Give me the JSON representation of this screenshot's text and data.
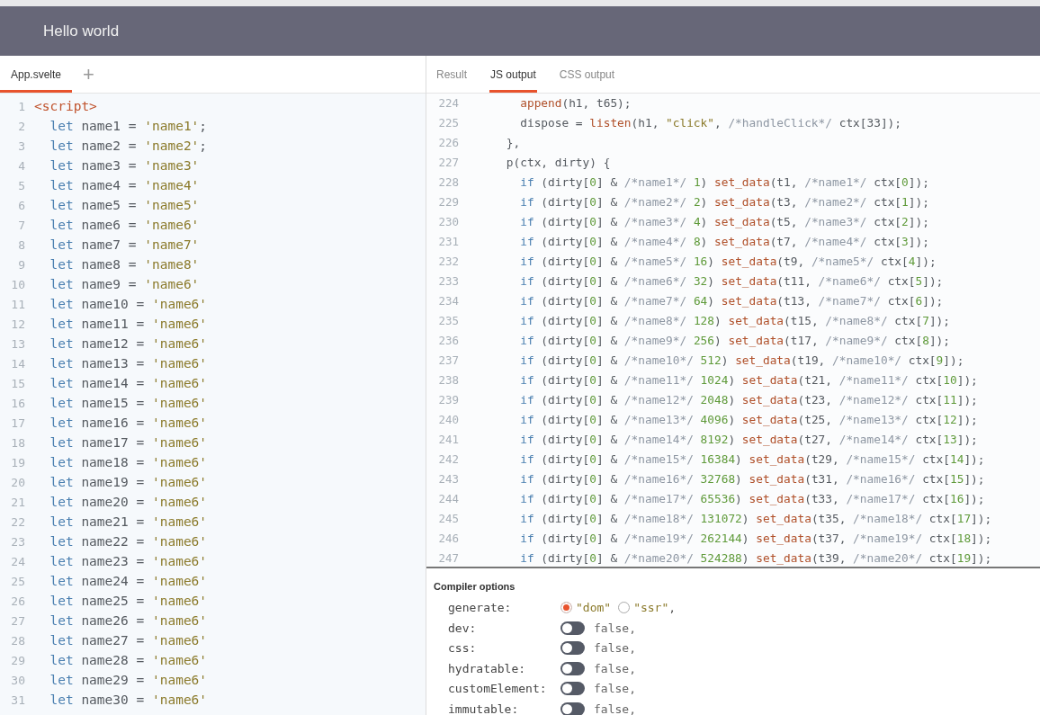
{
  "header": {
    "title": "Hello world"
  },
  "editor": {
    "tabs": [
      {
        "label": "App.svelte",
        "selected": true
      }
    ],
    "add_button": "+",
    "lines": [
      {
        "number": "1",
        "tokens": [
          {
            "kind": "tag",
            "text": "<script>"
          }
        ]
      },
      {
        "number": "2",
        "tokens": [
          {
            "kind": "keyword",
            "text": "  let"
          },
          {
            "kind": "plain",
            "text": " name1 = "
          },
          {
            "kind": "string",
            "text": "'name1'"
          },
          {
            "kind": "plain",
            "text": ";"
          }
        ]
      },
      {
        "number": "3",
        "tokens": [
          {
            "kind": "keyword",
            "text": "  let"
          },
          {
            "kind": "plain",
            "text": " name2 = "
          },
          {
            "kind": "string",
            "text": "'name2'"
          },
          {
            "kind": "plain",
            "text": ";"
          }
        ]
      },
      {
        "number": "4",
        "tokens": [
          {
            "kind": "keyword",
            "text": "  let"
          },
          {
            "kind": "plain",
            "text": " name3 = "
          },
          {
            "kind": "string",
            "text": "'name3'"
          }
        ]
      },
      {
        "number": "5",
        "tokens": [
          {
            "kind": "keyword",
            "text": "  let"
          },
          {
            "kind": "plain",
            "text": " name4 = "
          },
          {
            "kind": "string",
            "text": "'name4'"
          }
        ]
      },
      {
        "number": "6",
        "tokens": [
          {
            "kind": "keyword",
            "text": "  let"
          },
          {
            "kind": "plain",
            "text": " name5 = "
          },
          {
            "kind": "string",
            "text": "'name5'"
          }
        ]
      },
      {
        "number": "7",
        "tokens": [
          {
            "kind": "keyword",
            "text": "  let"
          },
          {
            "kind": "plain",
            "text": " name6 = "
          },
          {
            "kind": "string",
            "text": "'name6'"
          }
        ]
      },
      {
        "number": "8",
        "tokens": [
          {
            "kind": "keyword",
            "text": "  let"
          },
          {
            "kind": "plain",
            "text": " name7 = "
          },
          {
            "kind": "string",
            "text": "'name7'"
          }
        ]
      },
      {
        "number": "9",
        "tokens": [
          {
            "kind": "keyword",
            "text": "  let"
          },
          {
            "kind": "plain",
            "text": " name8 = "
          },
          {
            "kind": "string",
            "text": "'name8'"
          }
        ]
      },
      {
        "number": "10",
        "tokens": [
          {
            "kind": "keyword",
            "text": "  let"
          },
          {
            "kind": "plain",
            "text": " name9 = "
          },
          {
            "kind": "string",
            "text": "'name6'"
          }
        ]
      },
      {
        "number": "11",
        "tokens": [
          {
            "kind": "keyword",
            "text": "  let"
          },
          {
            "kind": "plain",
            "text": " name10 = "
          },
          {
            "kind": "string",
            "text": "'name6'"
          }
        ]
      },
      {
        "number": "12",
        "tokens": [
          {
            "kind": "keyword",
            "text": "  let"
          },
          {
            "kind": "plain",
            "text": " name11 = "
          },
          {
            "kind": "string",
            "text": "'name6'"
          }
        ]
      },
      {
        "number": "13",
        "tokens": [
          {
            "kind": "keyword",
            "text": "  let"
          },
          {
            "kind": "plain",
            "text": " name12 = "
          },
          {
            "kind": "string",
            "text": "'name6'"
          }
        ]
      },
      {
        "number": "14",
        "tokens": [
          {
            "kind": "keyword",
            "text": "  let"
          },
          {
            "kind": "plain",
            "text": " name13 = "
          },
          {
            "kind": "string",
            "text": "'name6'"
          }
        ]
      },
      {
        "number": "15",
        "tokens": [
          {
            "kind": "keyword",
            "text": "  let"
          },
          {
            "kind": "plain",
            "text": " name14 = "
          },
          {
            "kind": "string",
            "text": "'name6'"
          }
        ]
      },
      {
        "number": "16",
        "tokens": [
          {
            "kind": "keyword",
            "text": "  let"
          },
          {
            "kind": "plain",
            "text": " name15 = "
          },
          {
            "kind": "string",
            "text": "'name6'"
          }
        ]
      },
      {
        "number": "17",
        "tokens": [
          {
            "kind": "keyword",
            "text": "  let"
          },
          {
            "kind": "plain",
            "text": " name16 = "
          },
          {
            "kind": "string",
            "text": "'name6'"
          }
        ]
      },
      {
        "number": "18",
        "tokens": [
          {
            "kind": "keyword",
            "text": "  let"
          },
          {
            "kind": "plain",
            "text": " name17 = "
          },
          {
            "kind": "string",
            "text": "'name6'"
          }
        ]
      },
      {
        "number": "19",
        "tokens": [
          {
            "kind": "keyword",
            "text": "  let"
          },
          {
            "kind": "plain",
            "text": " name18 = "
          },
          {
            "kind": "string",
            "text": "'name6'"
          }
        ]
      },
      {
        "number": "20",
        "tokens": [
          {
            "kind": "keyword",
            "text": "  let"
          },
          {
            "kind": "plain",
            "text": " name19 = "
          },
          {
            "kind": "string",
            "text": "'name6'"
          }
        ]
      },
      {
        "number": "21",
        "tokens": [
          {
            "kind": "keyword",
            "text": "  let"
          },
          {
            "kind": "plain",
            "text": " name20 = "
          },
          {
            "kind": "string",
            "text": "'name6'"
          }
        ]
      },
      {
        "number": "22",
        "tokens": [
          {
            "kind": "keyword",
            "text": "  let"
          },
          {
            "kind": "plain",
            "text": " name21 = "
          },
          {
            "kind": "string",
            "text": "'name6'"
          }
        ]
      },
      {
        "number": "23",
        "tokens": [
          {
            "kind": "keyword",
            "text": "  let"
          },
          {
            "kind": "plain",
            "text": " name22 = "
          },
          {
            "kind": "string",
            "text": "'name6'"
          }
        ]
      },
      {
        "number": "24",
        "tokens": [
          {
            "kind": "keyword",
            "text": "  let"
          },
          {
            "kind": "plain",
            "text": " name23 = "
          },
          {
            "kind": "string",
            "text": "'name6'"
          }
        ]
      },
      {
        "number": "25",
        "tokens": [
          {
            "kind": "keyword",
            "text": "  let"
          },
          {
            "kind": "plain",
            "text": " name24 = "
          },
          {
            "kind": "string",
            "text": "'name6'"
          }
        ]
      },
      {
        "number": "26",
        "tokens": [
          {
            "kind": "keyword",
            "text": "  let"
          },
          {
            "kind": "plain",
            "text": " name25 = "
          },
          {
            "kind": "string",
            "text": "'name6'"
          }
        ]
      },
      {
        "number": "27",
        "tokens": [
          {
            "kind": "keyword",
            "text": "  let"
          },
          {
            "kind": "plain",
            "text": " name26 = "
          },
          {
            "kind": "string",
            "text": "'name6'"
          }
        ]
      },
      {
        "number": "28",
        "tokens": [
          {
            "kind": "keyword",
            "text": "  let"
          },
          {
            "kind": "plain",
            "text": " name27 = "
          },
          {
            "kind": "string",
            "text": "'name6'"
          }
        ]
      },
      {
        "number": "29",
        "tokens": [
          {
            "kind": "keyword",
            "text": "  let"
          },
          {
            "kind": "plain",
            "text": " name28 = "
          },
          {
            "kind": "string",
            "text": "'name6'"
          }
        ]
      },
      {
        "number": "30",
        "tokens": [
          {
            "kind": "keyword",
            "text": "  let"
          },
          {
            "kind": "plain",
            "text": " name29 = "
          },
          {
            "kind": "string",
            "text": "'name6'"
          }
        ]
      },
      {
        "number": "31",
        "tokens": [
          {
            "kind": "keyword",
            "text": "  let"
          },
          {
            "kind": "plain",
            "text": " name30 = "
          },
          {
            "kind": "string",
            "text": "'name6'"
          }
        ]
      }
    ]
  },
  "output": {
    "tabs": [
      {
        "label": "Result",
        "selected": false
      },
      {
        "label": "JS output",
        "selected": true
      },
      {
        "label": "CSS output",
        "selected": false
      }
    ],
    "lines": [
      {
        "number": "224",
        "tokens": [
          {
            "kind": "function",
            "text": "      append"
          },
          {
            "kind": "plain",
            "text": "(h1, t65);"
          }
        ]
      },
      {
        "number": "225",
        "tokens": [
          {
            "kind": "plain",
            "text": "      dispose = "
          },
          {
            "kind": "function",
            "text": "listen"
          },
          {
            "kind": "plain",
            "text": "(h1, "
          },
          {
            "kind": "string",
            "text": "\"click\""
          },
          {
            "kind": "plain",
            "text": ", "
          },
          {
            "kind": "comment",
            "text": "/*handleClick*/"
          },
          {
            "kind": "plain",
            "text": " ctx[33]);"
          }
        ]
      },
      {
        "number": "226",
        "tokens": [
          {
            "kind": "plain",
            "text": "    },"
          }
        ]
      },
      {
        "number": "227",
        "tokens": [
          {
            "kind": "plain",
            "text": "    p(ctx, dirty) {"
          }
        ]
      },
      {
        "number": "228",
        "tokens": [
          {
            "kind": "keyword",
            "text": "      if"
          },
          {
            "kind": "plain",
            "text": " (dirty["
          },
          {
            "kind": "number",
            "text": "0"
          },
          {
            "kind": "plain",
            "text": "] & "
          },
          {
            "kind": "comment",
            "text": "/*name1*/"
          },
          {
            "kind": "number",
            "text": " 1"
          },
          {
            "kind": "plain",
            "text": ") "
          },
          {
            "kind": "function",
            "text": "set_data"
          },
          {
            "kind": "plain",
            "text": "(t1, "
          },
          {
            "kind": "comment",
            "text": "/*name1*/"
          },
          {
            "kind": "plain",
            "text": " ctx["
          },
          {
            "kind": "number",
            "text": "0"
          },
          {
            "kind": "plain",
            "text": "]);"
          }
        ]
      },
      {
        "number": "229",
        "tokens": [
          {
            "kind": "keyword",
            "text": "      if"
          },
          {
            "kind": "plain",
            "text": " (dirty["
          },
          {
            "kind": "number",
            "text": "0"
          },
          {
            "kind": "plain",
            "text": "] & "
          },
          {
            "kind": "comment",
            "text": "/*name2*/"
          },
          {
            "kind": "number",
            "text": " 2"
          },
          {
            "kind": "plain",
            "text": ") "
          },
          {
            "kind": "function",
            "text": "set_data"
          },
          {
            "kind": "plain",
            "text": "(t3, "
          },
          {
            "kind": "comment",
            "text": "/*name2*/"
          },
          {
            "kind": "plain",
            "text": " ctx["
          },
          {
            "kind": "number",
            "text": "1"
          },
          {
            "kind": "plain",
            "text": "]);"
          }
        ]
      },
      {
        "number": "230",
        "tokens": [
          {
            "kind": "keyword",
            "text": "      if"
          },
          {
            "kind": "plain",
            "text": " (dirty["
          },
          {
            "kind": "number",
            "text": "0"
          },
          {
            "kind": "plain",
            "text": "] & "
          },
          {
            "kind": "comment",
            "text": "/*name3*/"
          },
          {
            "kind": "number",
            "text": " 4"
          },
          {
            "kind": "plain",
            "text": ") "
          },
          {
            "kind": "function",
            "text": "set_data"
          },
          {
            "kind": "plain",
            "text": "(t5, "
          },
          {
            "kind": "comment",
            "text": "/*name3*/"
          },
          {
            "kind": "plain",
            "text": " ctx["
          },
          {
            "kind": "number",
            "text": "2"
          },
          {
            "kind": "plain",
            "text": "]);"
          }
        ]
      },
      {
        "number": "231",
        "tokens": [
          {
            "kind": "keyword",
            "text": "      if"
          },
          {
            "kind": "plain",
            "text": " (dirty["
          },
          {
            "kind": "number",
            "text": "0"
          },
          {
            "kind": "plain",
            "text": "] & "
          },
          {
            "kind": "comment",
            "text": "/*name4*/"
          },
          {
            "kind": "number",
            "text": " 8"
          },
          {
            "kind": "plain",
            "text": ") "
          },
          {
            "kind": "function",
            "text": "set_data"
          },
          {
            "kind": "plain",
            "text": "(t7, "
          },
          {
            "kind": "comment",
            "text": "/*name4*/"
          },
          {
            "kind": "plain",
            "text": " ctx["
          },
          {
            "kind": "number",
            "text": "3"
          },
          {
            "kind": "plain",
            "text": "]);"
          }
        ]
      },
      {
        "number": "232",
        "tokens": [
          {
            "kind": "keyword",
            "text": "      if"
          },
          {
            "kind": "plain",
            "text": " (dirty["
          },
          {
            "kind": "number",
            "text": "0"
          },
          {
            "kind": "plain",
            "text": "] & "
          },
          {
            "kind": "comment",
            "text": "/*name5*/"
          },
          {
            "kind": "number",
            "text": " 16"
          },
          {
            "kind": "plain",
            "text": ") "
          },
          {
            "kind": "function",
            "text": "set_data"
          },
          {
            "kind": "plain",
            "text": "(t9, "
          },
          {
            "kind": "comment",
            "text": "/*name5*/"
          },
          {
            "kind": "plain",
            "text": " ctx["
          },
          {
            "kind": "number",
            "text": "4"
          },
          {
            "kind": "plain",
            "text": "]);"
          }
        ]
      },
      {
        "number": "233",
        "tokens": [
          {
            "kind": "keyword",
            "text": "      if"
          },
          {
            "kind": "plain",
            "text": " (dirty["
          },
          {
            "kind": "number",
            "text": "0"
          },
          {
            "kind": "plain",
            "text": "] & "
          },
          {
            "kind": "comment",
            "text": "/*name6*/"
          },
          {
            "kind": "number",
            "text": " 32"
          },
          {
            "kind": "plain",
            "text": ") "
          },
          {
            "kind": "function",
            "text": "set_data"
          },
          {
            "kind": "plain",
            "text": "(t11, "
          },
          {
            "kind": "comment",
            "text": "/*name6*/"
          },
          {
            "kind": "plain",
            "text": " ctx["
          },
          {
            "kind": "number",
            "text": "5"
          },
          {
            "kind": "plain",
            "text": "]);"
          }
        ]
      },
      {
        "number": "234",
        "tokens": [
          {
            "kind": "keyword",
            "text": "      if"
          },
          {
            "kind": "plain",
            "text": " (dirty["
          },
          {
            "kind": "number",
            "text": "0"
          },
          {
            "kind": "plain",
            "text": "] & "
          },
          {
            "kind": "comment",
            "text": "/*name7*/"
          },
          {
            "kind": "number",
            "text": " 64"
          },
          {
            "kind": "plain",
            "text": ") "
          },
          {
            "kind": "function",
            "text": "set_data"
          },
          {
            "kind": "plain",
            "text": "(t13, "
          },
          {
            "kind": "comment",
            "text": "/*name7*/"
          },
          {
            "kind": "plain",
            "text": " ctx["
          },
          {
            "kind": "number",
            "text": "6"
          },
          {
            "kind": "plain",
            "text": "]);"
          }
        ]
      },
      {
        "number": "235",
        "tokens": [
          {
            "kind": "keyword",
            "text": "      if"
          },
          {
            "kind": "plain",
            "text": " (dirty["
          },
          {
            "kind": "number",
            "text": "0"
          },
          {
            "kind": "plain",
            "text": "] & "
          },
          {
            "kind": "comment",
            "text": "/*name8*/"
          },
          {
            "kind": "number",
            "text": " 128"
          },
          {
            "kind": "plain",
            "text": ") "
          },
          {
            "kind": "function",
            "text": "set_data"
          },
          {
            "kind": "plain",
            "text": "(t15, "
          },
          {
            "kind": "comment",
            "text": "/*name8*/"
          },
          {
            "kind": "plain",
            "text": " ctx["
          },
          {
            "kind": "number",
            "text": "7"
          },
          {
            "kind": "plain",
            "text": "]);"
          }
        ]
      },
      {
        "number": "236",
        "tokens": [
          {
            "kind": "keyword",
            "text": "      if"
          },
          {
            "kind": "plain",
            "text": " (dirty["
          },
          {
            "kind": "number",
            "text": "0"
          },
          {
            "kind": "plain",
            "text": "] & "
          },
          {
            "kind": "comment",
            "text": "/*name9*/"
          },
          {
            "kind": "number",
            "text": " 256"
          },
          {
            "kind": "plain",
            "text": ") "
          },
          {
            "kind": "function",
            "text": "set_data"
          },
          {
            "kind": "plain",
            "text": "(t17, "
          },
          {
            "kind": "comment",
            "text": "/*name9*/"
          },
          {
            "kind": "plain",
            "text": " ctx["
          },
          {
            "kind": "number",
            "text": "8"
          },
          {
            "kind": "plain",
            "text": "]);"
          }
        ]
      },
      {
        "number": "237",
        "tokens": [
          {
            "kind": "keyword",
            "text": "      if"
          },
          {
            "kind": "plain",
            "text": " (dirty["
          },
          {
            "kind": "number",
            "text": "0"
          },
          {
            "kind": "plain",
            "text": "] & "
          },
          {
            "kind": "comment",
            "text": "/*name10*/"
          },
          {
            "kind": "number",
            "text": " 512"
          },
          {
            "kind": "plain",
            "text": ") "
          },
          {
            "kind": "function",
            "text": "set_data"
          },
          {
            "kind": "plain",
            "text": "(t19, "
          },
          {
            "kind": "comment",
            "text": "/*name10*/"
          },
          {
            "kind": "plain",
            "text": " ctx["
          },
          {
            "kind": "number",
            "text": "9"
          },
          {
            "kind": "plain",
            "text": "]);"
          }
        ]
      },
      {
        "number": "238",
        "tokens": [
          {
            "kind": "keyword",
            "text": "      if"
          },
          {
            "kind": "plain",
            "text": " (dirty["
          },
          {
            "kind": "number",
            "text": "0"
          },
          {
            "kind": "plain",
            "text": "] & "
          },
          {
            "kind": "comment",
            "text": "/*name11*/"
          },
          {
            "kind": "number",
            "text": " 1024"
          },
          {
            "kind": "plain",
            "text": ") "
          },
          {
            "kind": "function",
            "text": "set_data"
          },
          {
            "kind": "plain",
            "text": "(t21, "
          },
          {
            "kind": "comment",
            "text": "/*name11*/"
          },
          {
            "kind": "plain",
            "text": " ctx["
          },
          {
            "kind": "number",
            "text": "10"
          },
          {
            "kind": "plain",
            "text": "]);"
          }
        ]
      },
      {
        "number": "239",
        "tokens": [
          {
            "kind": "keyword",
            "text": "      if"
          },
          {
            "kind": "plain",
            "text": " (dirty["
          },
          {
            "kind": "number",
            "text": "0"
          },
          {
            "kind": "plain",
            "text": "] & "
          },
          {
            "kind": "comment",
            "text": "/*name12*/"
          },
          {
            "kind": "number",
            "text": " 2048"
          },
          {
            "kind": "plain",
            "text": ") "
          },
          {
            "kind": "function",
            "text": "set_data"
          },
          {
            "kind": "plain",
            "text": "(t23, "
          },
          {
            "kind": "comment",
            "text": "/*name12*/"
          },
          {
            "kind": "plain",
            "text": " ctx["
          },
          {
            "kind": "number",
            "text": "11"
          },
          {
            "kind": "plain",
            "text": "]);"
          }
        ]
      },
      {
        "number": "240",
        "tokens": [
          {
            "kind": "keyword",
            "text": "      if"
          },
          {
            "kind": "plain",
            "text": " (dirty["
          },
          {
            "kind": "number",
            "text": "0"
          },
          {
            "kind": "plain",
            "text": "] & "
          },
          {
            "kind": "comment",
            "text": "/*name13*/"
          },
          {
            "kind": "number",
            "text": " 4096"
          },
          {
            "kind": "plain",
            "text": ") "
          },
          {
            "kind": "function",
            "text": "set_data"
          },
          {
            "kind": "plain",
            "text": "(t25, "
          },
          {
            "kind": "comment",
            "text": "/*name13*/"
          },
          {
            "kind": "plain",
            "text": " ctx["
          },
          {
            "kind": "number",
            "text": "12"
          },
          {
            "kind": "plain",
            "text": "]);"
          }
        ]
      },
      {
        "number": "241",
        "tokens": [
          {
            "kind": "keyword",
            "text": "      if"
          },
          {
            "kind": "plain",
            "text": " (dirty["
          },
          {
            "kind": "number",
            "text": "0"
          },
          {
            "kind": "plain",
            "text": "] & "
          },
          {
            "kind": "comment",
            "text": "/*name14*/"
          },
          {
            "kind": "number",
            "text": " 8192"
          },
          {
            "kind": "plain",
            "text": ") "
          },
          {
            "kind": "function",
            "text": "set_data"
          },
          {
            "kind": "plain",
            "text": "(t27, "
          },
          {
            "kind": "comment",
            "text": "/*name14*/"
          },
          {
            "kind": "plain",
            "text": " ctx["
          },
          {
            "kind": "number",
            "text": "13"
          },
          {
            "kind": "plain",
            "text": "]);"
          }
        ]
      },
      {
        "number": "242",
        "tokens": [
          {
            "kind": "keyword",
            "text": "      if"
          },
          {
            "kind": "plain",
            "text": " (dirty["
          },
          {
            "kind": "number",
            "text": "0"
          },
          {
            "kind": "plain",
            "text": "] & "
          },
          {
            "kind": "comment",
            "text": "/*name15*/"
          },
          {
            "kind": "number",
            "text": " 16384"
          },
          {
            "kind": "plain",
            "text": ") "
          },
          {
            "kind": "function",
            "text": "set_data"
          },
          {
            "kind": "plain",
            "text": "(t29, "
          },
          {
            "kind": "comment",
            "text": "/*name15*/"
          },
          {
            "kind": "plain",
            "text": " ctx["
          },
          {
            "kind": "number",
            "text": "14"
          },
          {
            "kind": "plain",
            "text": "]);"
          }
        ]
      },
      {
        "number": "243",
        "tokens": [
          {
            "kind": "keyword",
            "text": "      if"
          },
          {
            "kind": "plain",
            "text": " (dirty["
          },
          {
            "kind": "number",
            "text": "0"
          },
          {
            "kind": "plain",
            "text": "] & "
          },
          {
            "kind": "comment",
            "text": "/*name16*/"
          },
          {
            "kind": "number",
            "text": " 32768"
          },
          {
            "kind": "plain",
            "text": ") "
          },
          {
            "kind": "function",
            "text": "set_data"
          },
          {
            "kind": "plain",
            "text": "(t31, "
          },
          {
            "kind": "comment",
            "text": "/*name16*/"
          },
          {
            "kind": "plain",
            "text": " ctx["
          },
          {
            "kind": "number",
            "text": "15"
          },
          {
            "kind": "plain",
            "text": "]);"
          }
        ]
      },
      {
        "number": "244",
        "tokens": [
          {
            "kind": "keyword",
            "text": "      if"
          },
          {
            "kind": "plain",
            "text": " (dirty["
          },
          {
            "kind": "number",
            "text": "0"
          },
          {
            "kind": "plain",
            "text": "] & "
          },
          {
            "kind": "comment",
            "text": "/*name17*/"
          },
          {
            "kind": "number",
            "text": " 65536"
          },
          {
            "kind": "plain",
            "text": ") "
          },
          {
            "kind": "function",
            "text": "set_data"
          },
          {
            "kind": "plain",
            "text": "(t33, "
          },
          {
            "kind": "comment",
            "text": "/*name17*/"
          },
          {
            "kind": "plain",
            "text": " ctx["
          },
          {
            "kind": "number",
            "text": "16"
          },
          {
            "kind": "plain",
            "text": "]);"
          }
        ]
      },
      {
        "number": "245",
        "tokens": [
          {
            "kind": "keyword",
            "text": "      if"
          },
          {
            "kind": "plain",
            "text": " (dirty["
          },
          {
            "kind": "number",
            "text": "0"
          },
          {
            "kind": "plain",
            "text": "] & "
          },
          {
            "kind": "comment",
            "text": "/*name18*/"
          },
          {
            "kind": "number",
            "text": " 131072"
          },
          {
            "kind": "plain",
            "text": ") "
          },
          {
            "kind": "function",
            "text": "set_data"
          },
          {
            "kind": "plain",
            "text": "(t35, "
          },
          {
            "kind": "comment",
            "text": "/*name18*/"
          },
          {
            "kind": "plain",
            "text": " ctx["
          },
          {
            "kind": "number",
            "text": "17"
          },
          {
            "kind": "plain",
            "text": "]);"
          }
        ]
      },
      {
        "number": "246",
        "tokens": [
          {
            "kind": "keyword",
            "text": "      if"
          },
          {
            "kind": "plain",
            "text": " (dirty["
          },
          {
            "kind": "number",
            "text": "0"
          },
          {
            "kind": "plain",
            "text": "] & "
          },
          {
            "kind": "comment",
            "text": "/*name19*/"
          },
          {
            "kind": "number",
            "text": " 262144"
          },
          {
            "kind": "plain",
            "text": ") "
          },
          {
            "kind": "function",
            "text": "set_data"
          },
          {
            "kind": "plain",
            "text": "(t37, "
          },
          {
            "kind": "comment",
            "text": "/*name19*/"
          },
          {
            "kind": "plain",
            "text": " ctx["
          },
          {
            "kind": "number",
            "text": "18"
          },
          {
            "kind": "plain",
            "text": "]);"
          }
        ]
      },
      {
        "number": "247",
        "tokens": [
          {
            "kind": "keyword",
            "text": "      if"
          },
          {
            "kind": "plain",
            "text": " (dirty["
          },
          {
            "kind": "number",
            "text": "0"
          },
          {
            "kind": "plain",
            "text": "] & "
          },
          {
            "kind": "comment",
            "text": "/*name20*/"
          },
          {
            "kind": "number",
            "text": " 524288"
          },
          {
            "kind": "plain",
            "text": ") "
          },
          {
            "kind": "function",
            "text": "set_data"
          },
          {
            "kind": "plain",
            "text": "(t39, "
          },
          {
            "kind": "comment",
            "text": "/*name20*/"
          },
          {
            "kind": "plain",
            "text": " ctx["
          },
          {
            "kind": "number",
            "text": "19"
          },
          {
            "kind": "plain",
            "text": "]);"
          }
        ]
      }
    ]
  },
  "compiler_options": {
    "title": "Compiler options",
    "options": [
      {
        "kind": "radio",
        "label": "generate:",
        "choices": [
          {
            "label": "\"dom\"",
            "selected": true
          },
          {
            "label": "\"ssr\"",
            "selected": false
          }
        ],
        "suffix": ","
      },
      {
        "kind": "toggle",
        "label": "dev:",
        "on": false,
        "value": "false,"
      },
      {
        "kind": "toggle",
        "label": "css:",
        "on": false,
        "value": "false,"
      },
      {
        "kind": "toggle",
        "label": "hydratable:",
        "on": false,
        "value": "false,"
      },
      {
        "kind": "toggle",
        "label": "customElement:",
        "on": false,
        "value": "false,"
      },
      {
        "kind": "toggle",
        "label": "immutable:",
        "on": false,
        "value": "false,"
      }
    ]
  }
}
